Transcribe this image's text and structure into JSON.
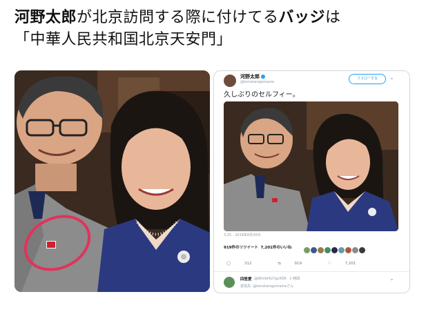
{
  "headline": {
    "line1_name": "河野太郎",
    "line1_mid": "が北京訪問する際に付けてる",
    "line1_badge": "バッジ",
    "line1_end": "は",
    "line2": "「中華人民共和国北京天安門」"
  },
  "tweet": {
    "author_name": "河野太郎",
    "author_handle": "@konotarogomame",
    "follow_label": "フォローする",
    "text": "久しぶりのセルフィー。",
    "timestamp": "3:25 - 2019年8月20日",
    "retweets": "919件のリツイート",
    "likes": "7,201件のいいね",
    "actions": {
      "replies": "312",
      "retweets": "919",
      "likes": "7,201"
    },
    "reply": {
      "name": "四笙愛",
      "handle": "@Whilet427gcXO6 · 1 時間",
      "to": "返信先: @konotarogomameさん"
    }
  },
  "colors": {
    "annotation_circle": "#e0335c",
    "twitter_blue": "#1da1f2"
  }
}
